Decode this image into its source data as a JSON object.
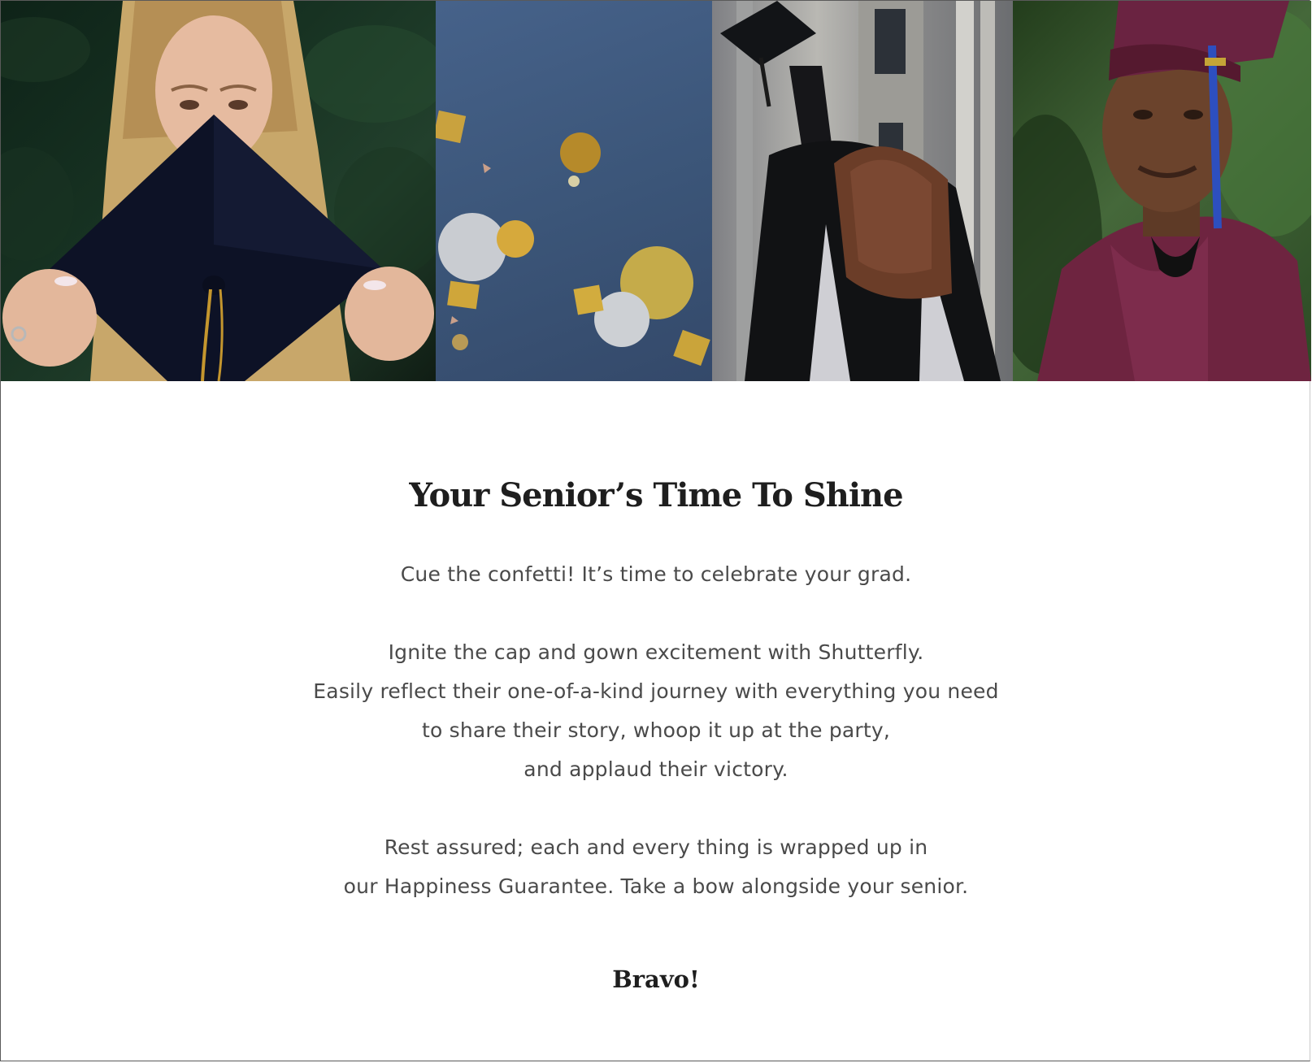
{
  "hero": {
    "images": [
      {
        "name": "grad-holding-cap-photo"
      },
      {
        "name": "confetti-on-blue-photo"
      },
      {
        "name": "grad-tossing-cap-photo"
      },
      {
        "name": "grad-maroon-gown-photo"
      }
    ]
  },
  "content": {
    "headline": "Your Senior’s Time To Shine",
    "intro": "Cue the confetti! It’s time to celebrate your grad.",
    "para1": [
      "Ignite the cap and gown excitement with Shutterfly.",
      "Easily reflect their one-of-a-kind journey with everything you need",
      "to share their story, whoop it up at the party,",
      "and applaud their victory."
    ],
    "para2": [
      "Rest assured; each and every thing is wrapped up in",
      "our Happiness Guarantee. Take a bow alongside your senior."
    ],
    "signoff": "Bravo!"
  },
  "colors": {
    "headline": "#1e1e1e",
    "body_text": "#4a4a4a",
    "background": "#ffffff",
    "gown_maroon": "#6e2440",
    "confetti_blue": "#3b5578",
    "gold": "#c9a23e"
  }
}
